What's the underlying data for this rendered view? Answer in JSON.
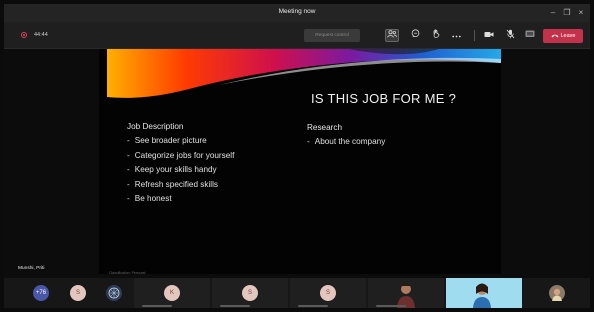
{
  "window": {
    "title": "Meeting now",
    "controls": {
      "minimize": "–",
      "restore": "❐",
      "close": "×"
    }
  },
  "toolbar": {
    "timer": "44:44",
    "request_control_label": "Request control",
    "icons": [
      "participants-icon",
      "chat-icon",
      "reactions-icon",
      "more-icon",
      "camera-icon",
      "mic-off-icon",
      "share-icon"
    ],
    "leave_label": "Leave",
    "leave_color": "#c4314b"
  },
  "slide": {
    "title": "IS THIS JOB FOR ME ?",
    "left_column": {
      "heading": "Job Description",
      "items": [
        "See broader picture",
        "Categorize jobs for yourself",
        "Keep your skills handy",
        "Refresh specified skills",
        "Be honest"
      ]
    },
    "right_column": {
      "heading": "Research",
      "items": [
        "About the company"
      ]
    },
    "classification": "Classification: Personal"
  },
  "presenter_name": "Munshi, Priti",
  "participants": {
    "overflow_count": "+76",
    "tiles": [
      {
        "initial": "S",
        "color": "#e3c7bf"
      },
      {
        "initial": "",
        "color": "#2c3d57"
      },
      {
        "initial": "K",
        "color": "#e3c7bf"
      },
      {
        "initial": "S",
        "color": "#e3c7bf"
      },
      {
        "initial": "S",
        "color": "#e3c7bf"
      },
      {
        "initial": "",
        "color": "#7a5a4a"
      },
      {
        "initial": "",
        "color": "#5ec6e6"
      },
      {
        "initial": "",
        "color": "#8a7a6a"
      }
    ]
  }
}
